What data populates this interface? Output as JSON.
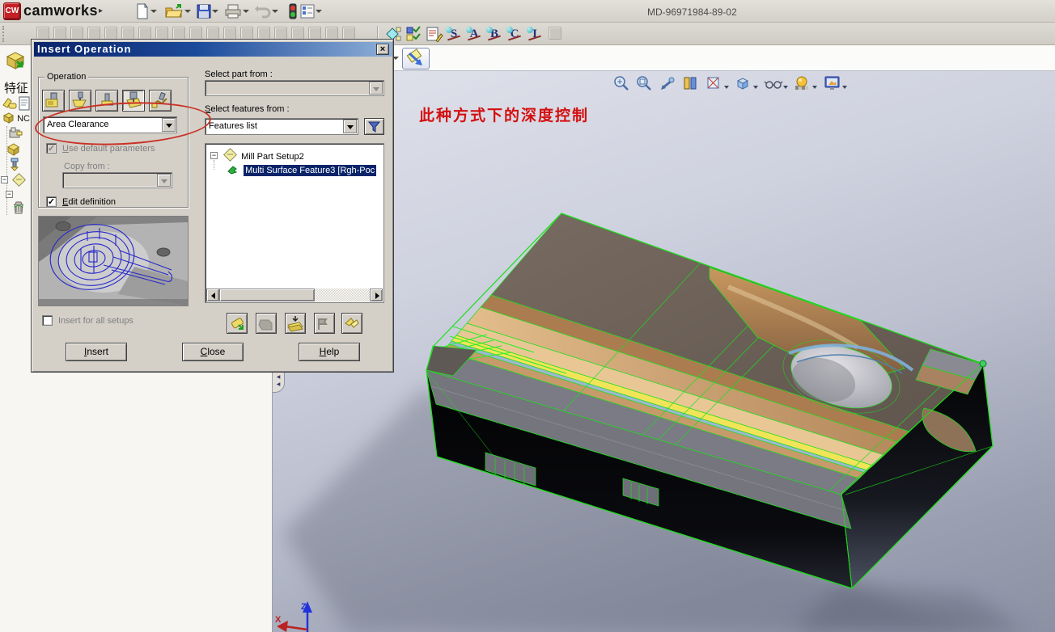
{
  "titlebar": {
    "brand": "camworks",
    "doc_title": "MD-96971984-89-02"
  },
  "cam_toolbar": {
    "letters": [
      "S",
      "A",
      "B",
      "C",
      "I"
    ]
  },
  "sidebar": {
    "feature_tab": "特征",
    "nc_label": "NC"
  },
  "dialog": {
    "title": "Insert Operation",
    "operation": {
      "group_label": "Operation",
      "method": "Area Clearance",
      "use_default": "Use default parameters",
      "copy_from": "Copy from :",
      "edit_definition": "Edit definition",
      "insert_all": "Insert for all setups"
    },
    "select_part_label": "Select part from :",
    "select_features_label": "Select features from :",
    "features_combo": "Features list",
    "tree": {
      "setup": "Mill Part Setup2",
      "feature": "Multi Surface Feature3 [Rgh-Poc"
    },
    "buttons": {
      "insert": "Insert",
      "close": "Close",
      "help": "Help"
    }
  },
  "viewport": {
    "annotation": "此种方式下的深度控制",
    "axis_z": "Z",
    "axis_x": "X"
  },
  "colors": {
    "wireframe_green": "#19e019",
    "annotation_red": "#d40f0f",
    "selection_blue": "#0a246a",
    "dialog_bg": "#d4d0c8"
  }
}
